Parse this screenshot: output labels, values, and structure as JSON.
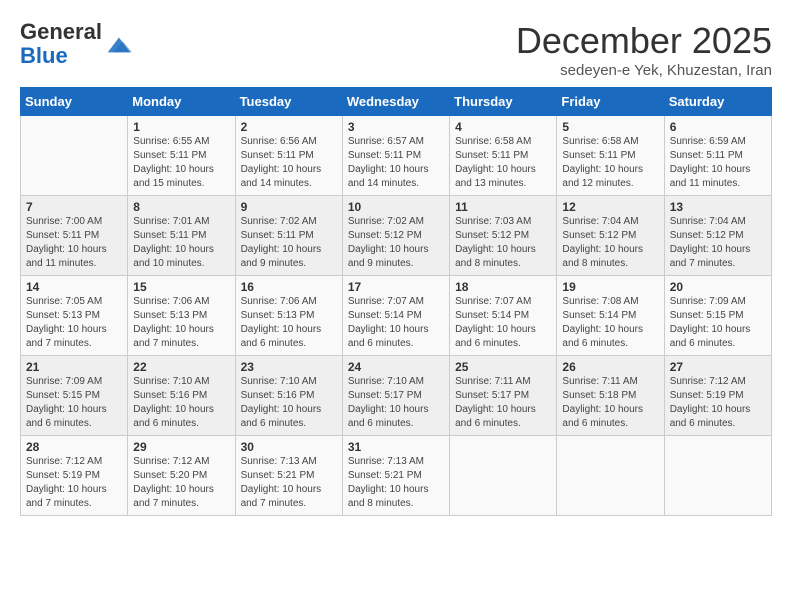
{
  "logo": {
    "general": "General",
    "blue": "Blue"
  },
  "header": {
    "month": "December 2025",
    "location": "sedeyen-e Yek, Khuzestan, Iran"
  },
  "weekdays": [
    "Sunday",
    "Monday",
    "Tuesday",
    "Wednesday",
    "Thursday",
    "Friday",
    "Saturday"
  ],
  "weeks": [
    [
      {
        "day": "",
        "info": ""
      },
      {
        "day": "1",
        "info": "Sunrise: 6:55 AM\nSunset: 5:11 PM\nDaylight: 10 hours\nand 15 minutes."
      },
      {
        "day": "2",
        "info": "Sunrise: 6:56 AM\nSunset: 5:11 PM\nDaylight: 10 hours\nand 14 minutes."
      },
      {
        "day": "3",
        "info": "Sunrise: 6:57 AM\nSunset: 5:11 PM\nDaylight: 10 hours\nand 14 minutes."
      },
      {
        "day": "4",
        "info": "Sunrise: 6:58 AM\nSunset: 5:11 PM\nDaylight: 10 hours\nand 13 minutes."
      },
      {
        "day": "5",
        "info": "Sunrise: 6:58 AM\nSunset: 5:11 PM\nDaylight: 10 hours\nand 12 minutes."
      },
      {
        "day": "6",
        "info": "Sunrise: 6:59 AM\nSunset: 5:11 PM\nDaylight: 10 hours\nand 11 minutes."
      }
    ],
    [
      {
        "day": "7",
        "info": "Sunrise: 7:00 AM\nSunset: 5:11 PM\nDaylight: 10 hours\nand 11 minutes."
      },
      {
        "day": "8",
        "info": "Sunrise: 7:01 AM\nSunset: 5:11 PM\nDaylight: 10 hours\nand 10 minutes."
      },
      {
        "day": "9",
        "info": "Sunrise: 7:02 AM\nSunset: 5:11 PM\nDaylight: 10 hours\nand 9 minutes."
      },
      {
        "day": "10",
        "info": "Sunrise: 7:02 AM\nSunset: 5:12 PM\nDaylight: 10 hours\nand 9 minutes."
      },
      {
        "day": "11",
        "info": "Sunrise: 7:03 AM\nSunset: 5:12 PM\nDaylight: 10 hours\nand 8 minutes."
      },
      {
        "day": "12",
        "info": "Sunrise: 7:04 AM\nSunset: 5:12 PM\nDaylight: 10 hours\nand 8 minutes."
      },
      {
        "day": "13",
        "info": "Sunrise: 7:04 AM\nSunset: 5:12 PM\nDaylight: 10 hours\nand 7 minutes."
      }
    ],
    [
      {
        "day": "14",
        "info": "Sunrise: 7:05 AM\nSunset: 5:13 PM\nDaylight: 10 hours\nand 7 minutes."
      },
      {
        "day": "15",
        "info": "Sunrise: 7:06 AM\nSunset: 5:13 PM\nDaylight: 10 hours\nand 7 minutes."
      },
      {
        "day": "16",
        "info": "Sunrise: 7:06 AM\nSunset: 5:13 PM\nDaylight: 10 hours\nand 6 minutes."
      },
      {
        "day": "17",
        "info": "Sunrise: 7:07 AM\nSunset: 5:14 PM\nDaylight: 10 hours\nand 6 minutes."
      },
      {
        "day": "18",
        "info": "Sunrise: 7:07 AM\nSunset: 5:14 PM\nDaylight: 10 hours\nand 6 minutes."
      },
      {
        "day": "19",
        "info": "Sunrise: 7:08 AM\nSunset: 5:14 PM\nDaylight: 10 hours\nand 6 minutes."
      },
      {
        "day": "20",
        "info": "Sunrise: 7:09 AM\nSunset: 5:15 PM\nDaylight: 10 hours\nand 6 minutes."
      }
    ],
    [
      {
        "day": "21",
        "info": "Sunrise: 7:09 AM\nSunset: 5:15 PM\nDaylight: 10 hours\nand 6 minutes."
      },
      {
        "day": "22",
        "info": "Sunrise: 7:10 AM\nSunset: 5:16 PM\nDaylight: 10 hours\nand 6 minutes."
      },
      {
        "day": "23",
        "info": "Sunrise: 7:10 AM\nSunset: 5:16 PM\nDaylight: 10 hours\nand 6 minutes."
      },
      {
        "day": "24",
        "info": "Sunrise: 7:10 AM\nSunset: 5:17 PM\nDaylight: 10 hours\nand 6 minutes."
      },
      {
        "day": "25",
        "info": "Sunrise: 7:11 AM\nSunset: 5:17 PM\nDaylight: 10 hours\nand 6 minutes."
      },
      {
        "day": "26",
        "info": "Sunrise: 7:11 AM\nSunset: 5:18 PM\nDaylight: 10 hours\nand 6 minutes."
      },
      {
        "day": "27",
        "info": "Sunrise: 7:12 AM\nSunset: 5:19 PM\nDaylight: 10 hours\nand 6 minutes."
      }
    ],
    [
      {
        "day": "28",
        "info": "Sunrise: 7:12 AM\nSunset: 5:19 PM\nDaylight: 10 hours\nand 7 minutes."
      },
      {
        "day": "29",
        "info": "Sunrise: 7:12 AM\nSunset: 5:20 PM\nDaylight: 10 hours\nand 7 minutes."
      },
      {
        "day": "30",
        "info": "Sunrise: 7:13 AM\nSunset: 5:21 PM\nDaylight: 10 hours\nand 7 minutes."
      },
      {
        "day": "31",
        "info": "Sunrise: 7:13 AM\nSunset: 5:21 PM\nDaylight: 10 hours\nand 8 minutes."
      },
      {
        "day": "",
        "info": ""
      },
      {
        "day": "",
        "info": ""
      },
      {
        "day": "",
        "info": ""
      }
    ]
  ]
}
